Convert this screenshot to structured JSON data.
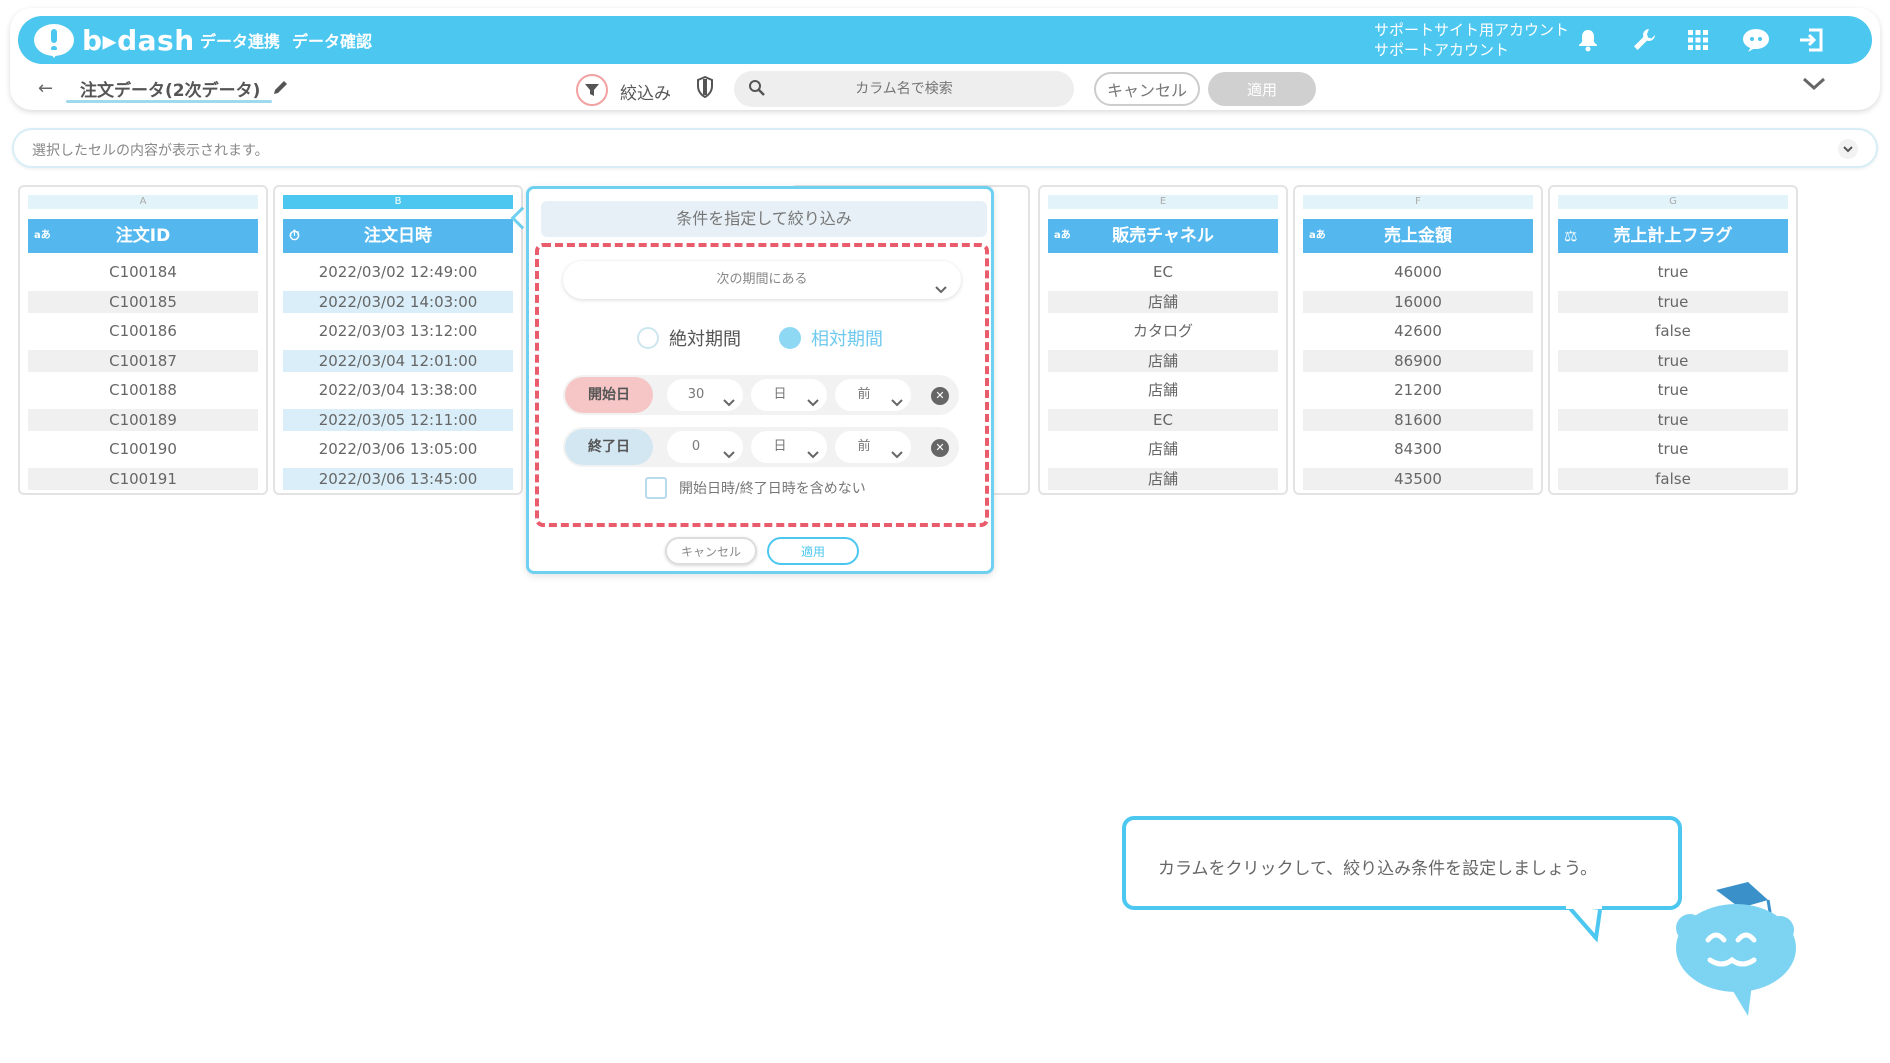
{
  "header": {
    "logo_text": "b▸dash",
    "nav": [
      "データ連携",
      "データ確認"
    ],
    "account_line1": "サポートサイト用アカウント",
    "account_line2": "サポートアカウント",
    "icons": [
      "bell-icon",
      "wrench-icon",
      "grid-icon",
      "chat-icon",
      "logout-icon"
    ]
  },
  "subbar": {
    "back": "←",
    "dataset_title": "注文データ(2次データ)",
    "filter_label": "絞込み",
    "search_placeholder": "カラム名で検索",
    "cancel_label": "キャンセル",
    "apply_label": "適用"
  },
  "cellbar": {
    "text": "選択したセルの内容が表示されます。"
  },
  "columns": [
    {
      "letter": "A",
      "type": "aあ",
      "name": "注文ID",
      "cells": [
        "C100184",
        "C100185",
        "C100186",
        "C100187",
        "C100188",
        "C100189",
        "C100190",
        "C100191"
      ]
    },
    {
      "letter": "B",
      "type": "⏱",
      "name": "注文日時",
      "cells": [
        "2022/03/02 12:49:00",
        "2022/03/02 14:03:00",
        "2022/03/03 13:12:00",
        "2022/03/04 12:01:00",
        "2022/03/04 13:38:00",
        "2022/03/05 12:11:00",
        "2022/03/06 13:05:00",
        "2022/03/06 13:45:00"
      ]
    },
    {
      "letter": "E",
      "type": "aあ",
      "name": "販売チャネル",
      "cells": [
        "EC",
        "店舗",
        "カタログ",
        "店舗",
        "店舗",
        "EC",
        "店舗",
        "店舗"
      ]
    },
    {
      "letter": "F",
      "type": "aあ",
      "name": "売上金額",
      "cells": [
        "46000",
        "16000",
        "42600",
        "86900",
        "21200",
        "81600",
        "84300",
        "43500"
      ]
    },
    {
      "letter": "G",
      "type": "⚖",
      "name": "売上計上フラグ",
      "cells": [
        "true",
        "true",
        "false",
        "true",
        "true",
        "true",
        "true",
        "false"
      ]
    }
  ],
  "popup": {
    "title": "条件を指定して絞り込み",
    "period_select": "次の期間にある",
    "radio_absolute": "絶対期間",
    "radio_relative": "相対期間",
    "start_label": "開始日",
    "start_amount": "30",
    "start_unit": "日",
    "start_dir": "前",
    "end_label": "終了日",
    "end_amount": "0",
    "end_unit": "日",
    "end_dir": "前",
    "exclude_label": "開始日時/終了日時を含めない",
    "cancel_label": "キャンセル",
    "apply_label": "適用"
  },
  "tooltip": {
    "text": "カラムをクリックして、絞り込み条件を設定しましょう。"
  },
  "colors": {
    "brand": "#4cc7ef",
    "header_col": "#54b8ef",
    "highlight_dash": "#e85c6c"
  }
}
